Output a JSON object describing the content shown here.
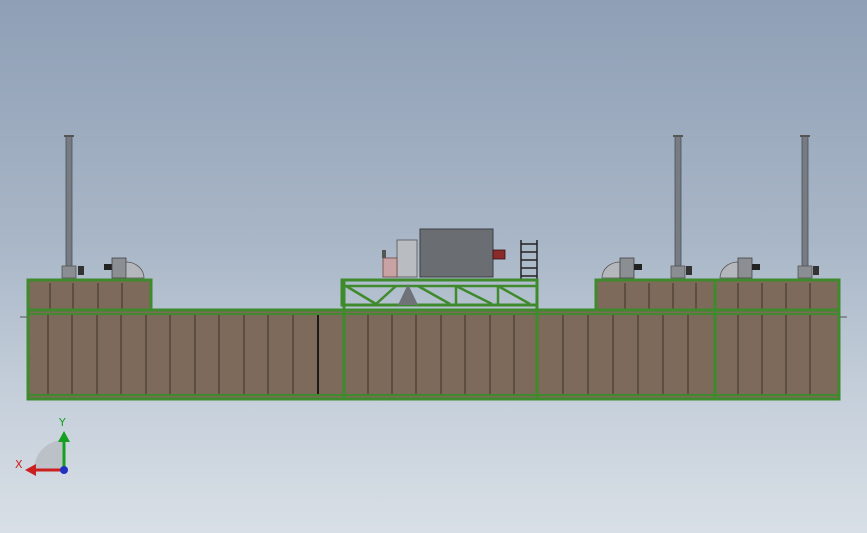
{
  "scene": {
    "colors": {
      "frame": "#3f8a2c",
      "frame_dark": "#2b5f1f",
      "panel": "#7d6a5a",
      "panel_line": "#3a3128",
      "stack": "#7c8088",
      "machine": "#6a6d72",
      "accent_red": "#c0504d"
    }
  },
  "triad": {
    "x_label": "X",
    "y_label": "Y",
    "colors": {
      "x": "#cc2020",
      "y": "#17a020",
      "z": "#2030c0"
    }
  }
}
